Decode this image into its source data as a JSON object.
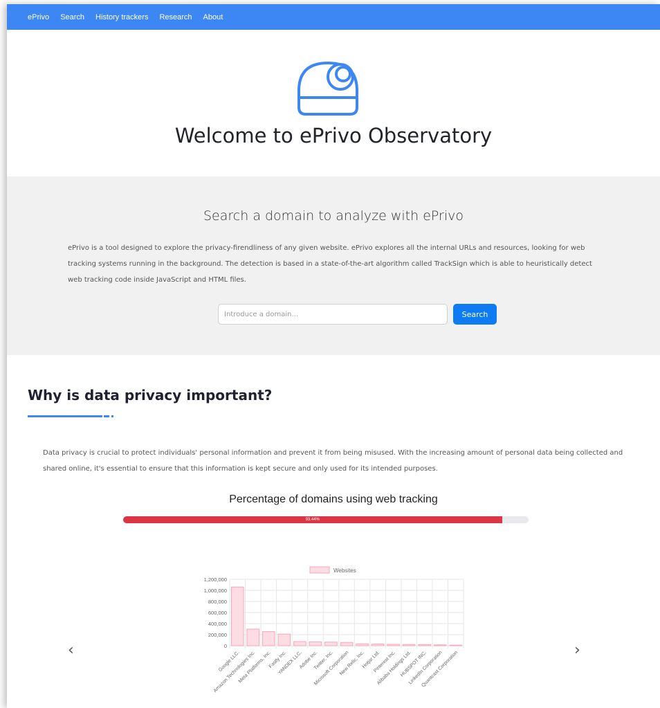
{
  "nav": {
    "items": [
      "ePrivo",
      "Search",
      "History trackers",
      "Research",
      "About"
    ]
  },
  "hero": {
    "title": "Welcome to ePrivo Observatory",
    "logo_icon": "observatory-dome-icon",
    "accent": "#3d87f5"
  },
  "search": {
    "heading": "Search a domain to analyze with ePrivo",
    "description": "ePrivo is a tool designed to explore the privacy-firendliness of any given website. ePrivo explores all the internal URLs and resources, looking for web tracking systems running in the background. The detection is based in a state-of-the-art algorithm called TrackSign which is able to heuristically detect web tracking code inside JavaScript and HTML files.",
    "placeholder": "Introduce a domain...",
    "button": "Search"
  },
  "privacy": {
    "heading": "Why is data privacy important?",
    "text": "Data privacy is crucial to protect individuals' personal information and prevent it from being misused. With the increasing amount of personal data being collected and shared online, it's essential to ensure that this information is kept secure and only used for its intended purposes.",
    "progress_title": "Percentage of domains using web tracking",
    "progress_label": "93.44%",
    "progress_value": 93.44,
    "progress_color": "#dc3545"
  },
  "carousel": {
    "prev_icon": "chevron-left-icon",
    "next_icon": "chevron-right-icon",
    "prev": "‹",
    "next": "›"
  },
  "chart_data": {
    "type": "bar",
    "legend": "Websites",
    "legend_position": "top",
    "categories": [
      "Google LLC.",
      "Amazon Technologies Inc.",
      "Meta Platforms, Inc.",
      "Fastly Inc.",
      "YANDEX LLC.",
      "Adobe Inc.",
      "Twitter, Inc.",
      "Microsoft Corporation",
      "New Relic, Inc.",
      "Hotjar Ltd.",
      "Pinterest Inc.",
      "Alibaba Holdings Ltd.",
      "HUBSPOT INC.",
      "LinkedIn Corporation",
      "Quantcast Corporation"
    ],
    "values": [
      1060000,
      300000,
      255000,
      210000,
      75000,
      70000,
      65000,
      60000,
      35000,
      30000,
      25000,
      22000,
      20000,
      15000,
      10000
    ],
    "yticks": [
      "0",
      "200,000",
      "400,000",
      "600,000",
      "800,000",
      "1,000,000",
      "1,200,000"
    ],
    "ylim": [
      0,
      1200000
    ],
    "bar_fill": "#fddde3",
    "bar_stroke": "#f7a6b8",
    "grid": true
  }
}
